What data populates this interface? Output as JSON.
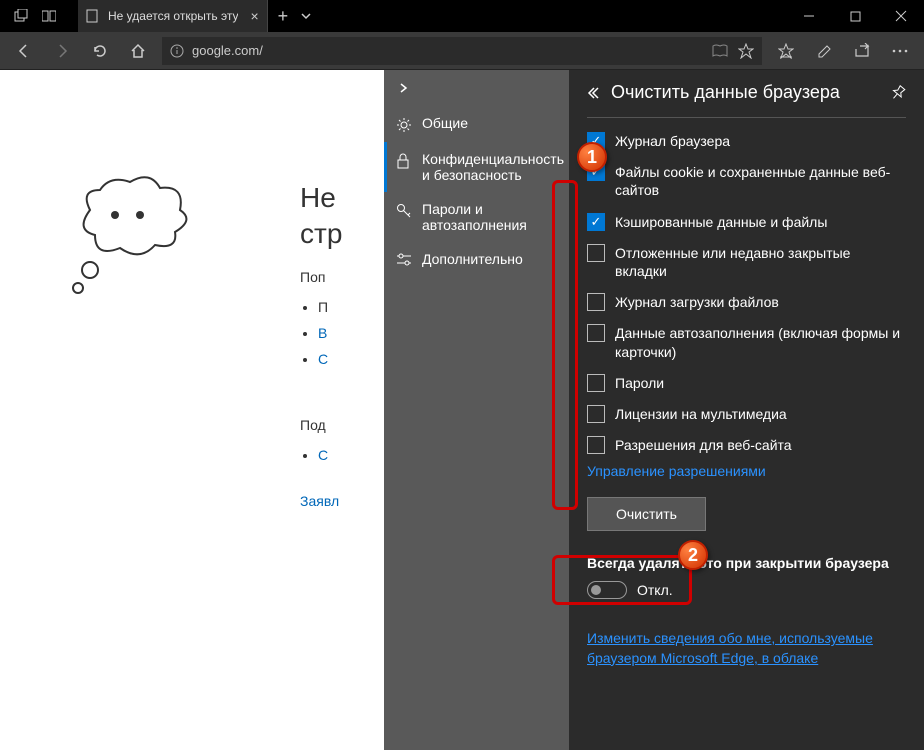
{
  "tab": {
    "title": "Не удается открыть эту"
  },
  "url": "google.com/",
  "page": {
    "h1a": "Не",
    "h1b": "стр",
    "sub": "Поп",
    "li1": "П",
    "li2": "В",
    "li3": "С",
    "det": "Под",
    "link2": "С",
    "decl": "Заявл"
  },
  "menu": {
    "items": [
      "Общие",
      "Конфиденциальность и безопасность",
      "Пароли и автозаполнения",
      "Дополнительно"
    ]
  },
  "panel": {
    "title": "Очистить данные браузера",
    "cb": [
      {
        "label": "Журнал браузера",
        "checked": true
      },
      {
        "label": "Файлы cookie и сохраненные данные веб-сайтов",
        "checked": true
      },
      {
        "label": "Кэшированные данные и файлы",
        "checked": true
      },
      {
        "label": "Отложенные или недавно закрытые вкладки",
        "checked": false
      },
      {
        "label": "Журнал загрузки файлов",
        "checked": false
      },
      {
        "label": "Данные автозаполнения (включая формы и карточки)",
        "checked": false
      },
      {
        "label": "Пароли",
        "checked": false
      },
      {
        "label": "Лицензии на мультимедиа",
        "checked": false
      },
      {
        "label": "Разрешения для веб-сайта",
        "checked": false
      }
    ],
    "mgmt": "Управление разрешениями",
    "clearbtn": "Очистить",
    "always": "Всегда удалять это при закрытии браузера",
    "toggle": "Откл.",
    "cloud": "Изменить сведения обо мне, используемые браузером Microsoft Edge, в облаке"
  },
  "badges": {
    "b1": "1",
    "b2": "2"
  }
}
